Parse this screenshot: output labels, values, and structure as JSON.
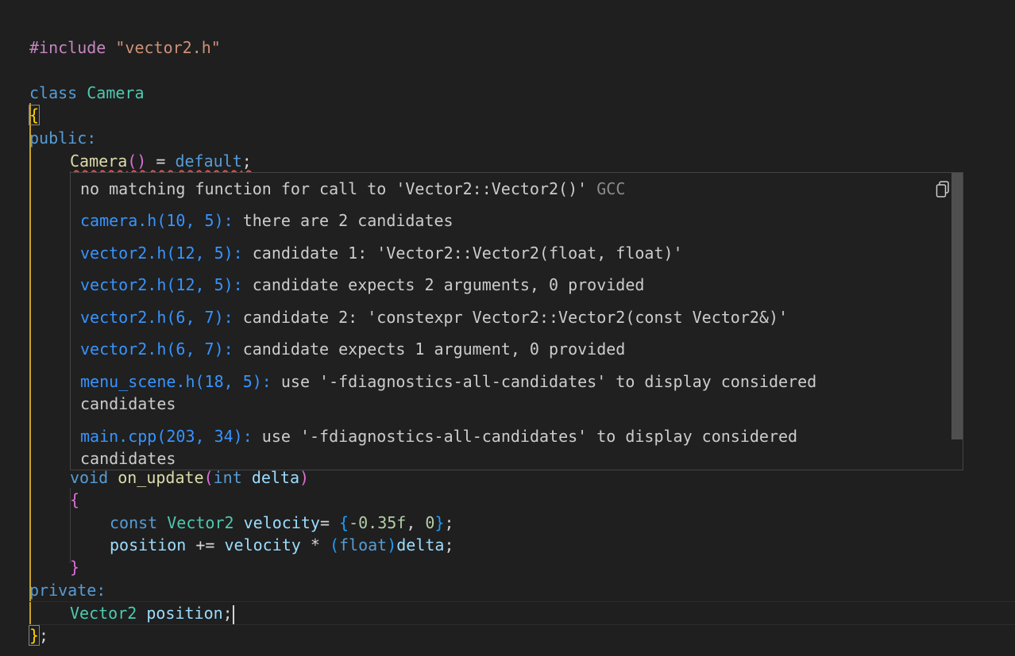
{
  "code": {
    "include_directive": "#include",
    "include_file": "\"vector2.h\"",
    "class_kw": "class",
    "class_name": "Camera",
    "open_brace": "{",
    "public_kw": "public:",
    "ctor_name": "Camera",
    "ctor_parens": "()",
    "ctor_eq": " = ",
    "ctor_default": "default",
    "ctor_semi": ";",
    "void_kw": "void",
    "method_name": "on_update",
    "paren_open": "(",
    "int_kw": "int",
    "param_name": "delta",
    "paren_close": ")",
    "method_open": "{",
    "const_kw": "const",
    "vec_type": "Vector2",
    "velocity_var": "velocity",
    "assign": "= ",
    "init_open": "{",
    "init_val1": "-0.35f",
    "init_sep": ", ",
    "init_val2": "0",
    "init_close": "}",
    "semi": ";",
    "position_var": "position",
    "plus_eq": " += ",
    "velocity_ref": "velocity",
    "mul": " * ",
    "cast_open": "(",
    "cast_type": "float",
    "cast_close": ")",
    "delta_ref": "delta",
    "semi2": ";",
    "method_close": "}",
    "private_kw": "private:",
    "member_type": "Vector2",
    "member_name": "position",
    "member_semi": ";",
    "class_close": "}",
    "class_semi": ";"
  },
  "hover": {
    "message": "no matching function for call to 'Vector2::Vector2()'",
    "source": "GCC",
    "copy_icon": "copy-icon",
    "related": [
      {
        "location": "camera.h(10, 5):",
        "text": " there are 2 candidates"
      },
      {
        "location": "vector2.h(12, 5):",
        "text": " candidate 1: 'Vector2::Vector2(float, float)'"
      },
      {
        "location": "vector2.h(12, 5):",
        "text": " candidate expects 2 arguments, 0 provided"
      },
      {
        "location": "vector2.h(6, 7):",
        "text": " candidate 2: 'constexpr Vector2::Vector2(const Vector2&)'"
      },
      {
        "location": "vector2.h(6, 7):",
        "text": " candidate expects 1 argument, 0 provided"
      },
      {
        "location": "menu_scene.h(18, 5):",
        "text": " use '-fdiagnostics-all-candidates' to display considered candidates"
      },
      {
        "location": "main.cpp(203, 34):",
        "text": " use '-fdiagnostics-all-candidates' to display considered candidates"
      }
    ]
  },
  "colors": {
    "background": "#1f1f1f",
    "keyword": "#569cd6",
    "type": "#4ec9b0",
    "function": "#dcdcaa",
    "link": "#3794ff",
    "error": "#f14c4c"
  }
}
